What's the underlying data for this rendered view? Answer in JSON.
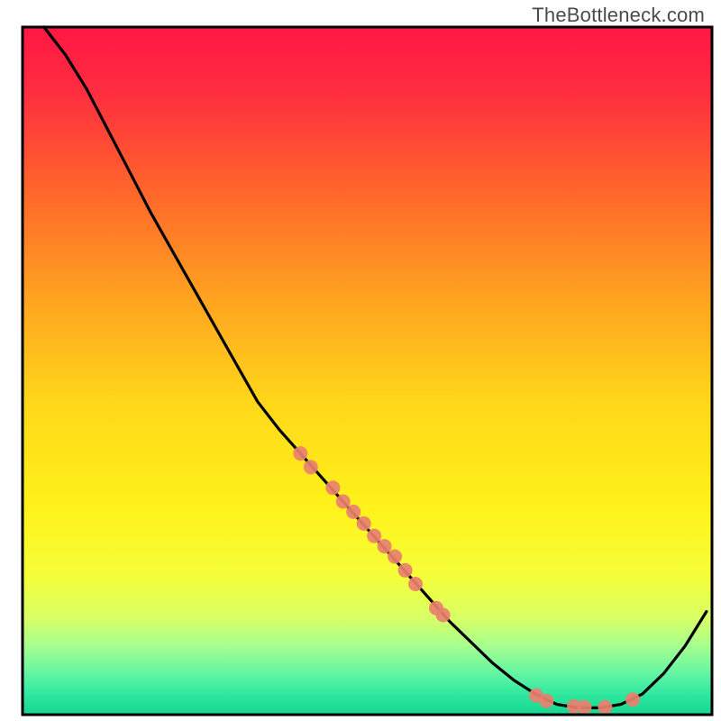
{
  "watermark": "TheBottleneck.com",
  "chart_data": {
    "type": "line",
    "title": "",
    "xlabel": "",
    "ylabel": "",
    "xlim": [
      0,
      100
    ],
    "ylim": [
      0,
      100
    ],
    "background_gradient": {
      "stops": [
        {
          "offset": 0.0,
          "color": "#ff1744"
        },
        {
          "offset": 0.1,
          "color": "#ff2f3f"
        },
        {
          "offset": 0.25,
          "color": "#ff6a2a"
        },
        {
          "offset": 0.4,
          "color": "#ffa51f"
        },
        {
          "offset": 0.55,
          "color": "#ffd81a"
        },
        {
          "offset": 0.7,
          "color": "#fff21a"
        },
        {
          "offset": 0.8,
          "color": "#f5ff3a"
        },
        {
          "offset": 0.86,
          "color": "#d8ff66"
        },
        {
          "offset": 0.9,
          "color": "#a6ff8e"
        },
        {
          "offset": 0.94,
          "color": "#63f5a3"
        },
        {
          "offset": 0.97,
          "color": "#30e8a0"
        },
        {
          "offset": 1.0,
          "color": "#16d68f"
        }
      ]
    },
    "series": [
      {
        "name": "bottleneck-curve",
        "x": [
          3.1,
          6.2,
          9.3,
          12.4,
          15.5,
          18.6,
          21.7,
          24.8,
          27.9,
          31.0,
          34.1,
          37.2,
          40.3,
          43.4,
          46.5,
          49.6,
          52.7,
          55.8,
          58.9,
          62.0,
          65.1,
          68.2,
          71.3,
          74.4,
          77.5,
          80.6,
          83.7,
          86.8,
          89.9,
          93.0,
          96.1,
          99.2
        ],
        "y": [
          100.0,
          96.0,
          91.0,
          85.0,
          79.0,
          73.0,
          67.5,
          62.0,
          56.5,
          51.0,
          45.5,
          41.5,
          38.0,
          34.5,
          31.0,
          27.5,
          24.0,
          20.5,
          17.0,
          13.5,
          10.5,
          7.5,
          5.0,
          3.0,
          1.5,
          1.0,
          1.0,
          1.5,
          3.0,
          6.0,
          10.0,
          15.0
        ]
      }
    ],
    "scatter": {
      "name": "data-points",
      "color": "#e9806f",
      "radius": 8,
      "points": [
        {
          "x": 40.3,
          "y": 38.0
        },
        {
          "x": 41.8,
          "y": 36.0
        },
        {
          "x": 45.0,
          "y": 33.0
        },
        {
          "x": 46.5,
          "y": 31.0
        },
        {
          "x": 48.0,
          "y": 29.5
        },
        {
          "x": 49.5,
          "y": 27.8
        },
        {
          "x": 51.0,
          "y": 26.0
        },
        {
          "x": 52.5,
          "y": 24.5
        },
        {
          "x": 54.0,
          "y": 23.0
        },
        {
          "x": 55.5,
          "y": 21.0
        },
        {
          "x": 57.0,
          "y": 19.0
        },
        {
          "x": 60.0,
          "y": 15.5
        },
        {
          "x": 61.0,
          "y": 14.5
        },
        {
          "x": 74.5,
          "y": 2.8
        },
        {
          "x": 76.0,
          "y": 2.0
        },
        {
          "x": 80.0,
          "y": 1.2
        },
        {
          "x": 81.5,
          "y": 1.1
        },
        {
          "x": 84.5,
          "y": 1.1
        },
        {
          "x": 88.5,
          "y": 2.2
        }
      ]
    }
  }
}
